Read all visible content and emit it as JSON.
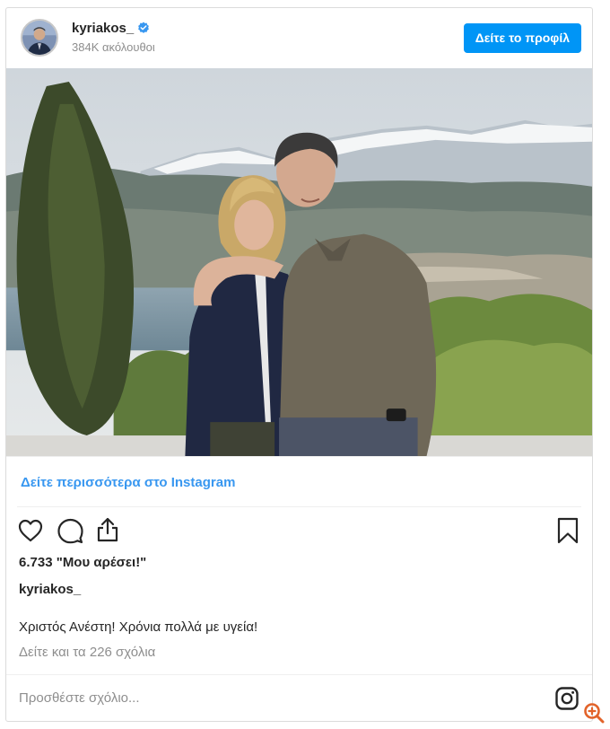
{
  "post": {
    "username": "kyriakos_",
    "followers": "384K ακόλουθοι",
    "view_profile_label": "Δείτε το προφίλ",
    "more_link": "Δείτε περισσότερα στο Instagram",
    "likes": "6.733 \"Μου αρέσει!\"",
    "caption_user": "kyriakos_",
    "caption_text": "Χριστός Ανέστη! Χρόνια πολλά με υγεία!",
    "comments_link": "Δείτε και τα 226 σχόλια",
    "add_comment_placeholder": "Προσθέστε σχόλιο..."
  },
  "icons": [
    "verified-badge-icon",
    "heart-icon",
    "comment-icon",
    "share-icon",
    "bookmark-icon",
    "instagram-icon",
    "zoom-icon"
  ],
  "colors": {
    "accent": "#0095f6",
    "link": "#3897f0",
    "muted": "#8e8e8e",
    "text": "#262626",
    "zoom": "#e2632a"
  }
}
